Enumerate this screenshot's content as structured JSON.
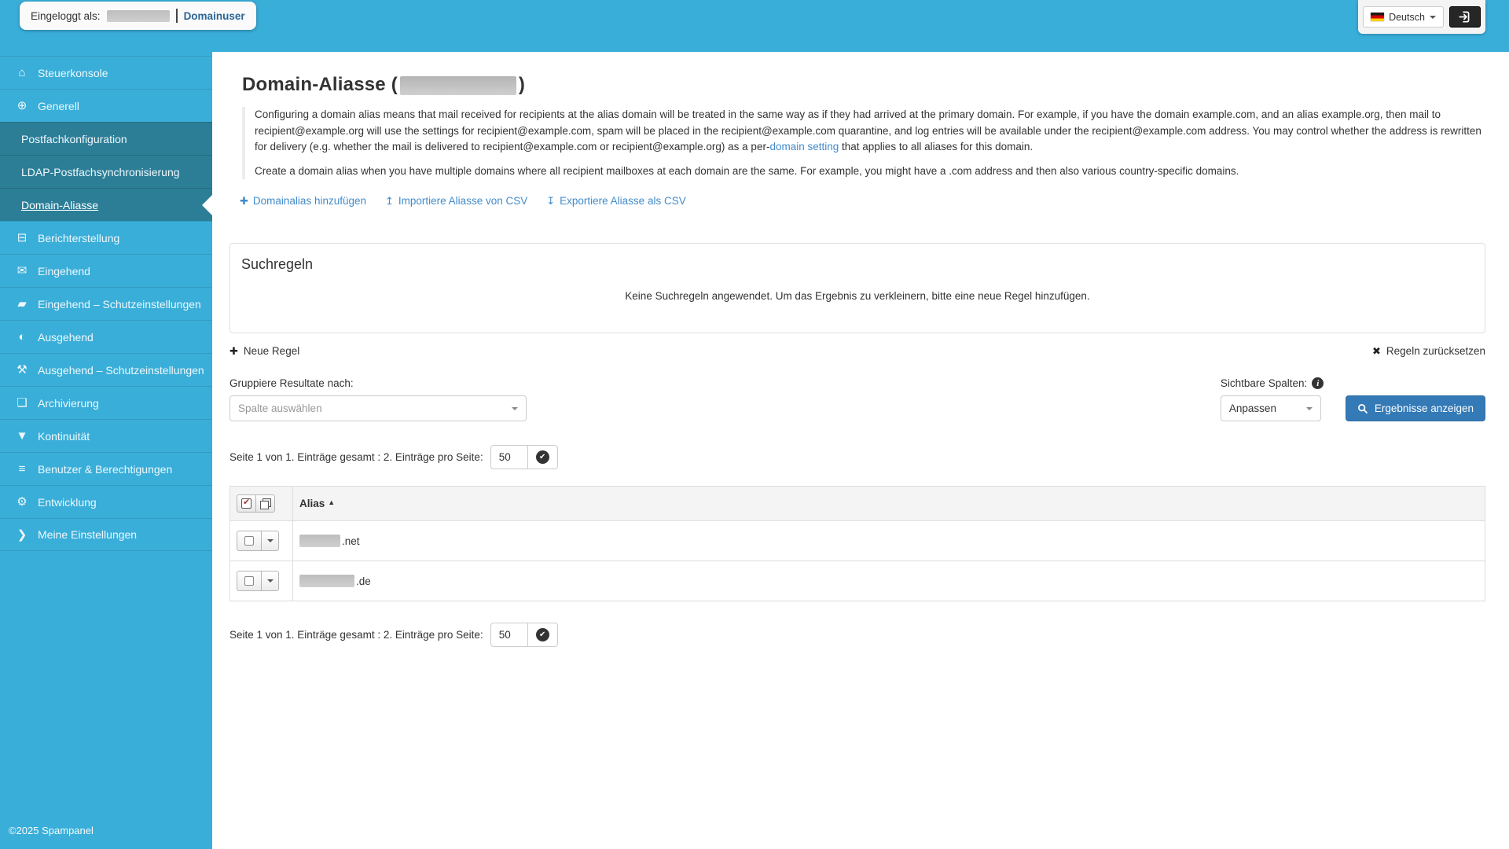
{
  "colors": {
    "accent": "#39aed9",
    "submenu": "#2c7e97",
    "link": "#428bca",
    "primary_button": "#337ab7"
  },
  "topbar": {
    "logged_in_label": "Eingeloggt als:",
    "role": "Domainuser",
    "language": "Deutsch"
  },
  "sidebar": {
    "items": [
      {
        "label": "Steuerkonsole",
        "icon": "home-icon"
      },
      {
        "label": "Generell",
        "icon": "globe-icon"
      },
      {
        "label": "Postfachkonfiguration",
        "sub": true
      },
      {
        "label": "LDAP-Postfachsynchronisierung",
        "sub": true
      },
      {
        "label": "Domain-Aliasse",
        "sub": true,
        "active": true
      },
      {
        "label": "Berichterstellung",
        "icon": "inbox-icon"
      },
      {
        "label": "Eingehend",
        "icon": "envelope-icon"
      },
      {
        "label": "Eingehend – Schutzeinstellungen",
        "icon": "folder-open-icon"
      },
      {
        "label": "Ausgehend",
        "icon": "adjust-icon"
      },
      {
        "label": "Ausgehend – Schutzeinstellungen",
        "icon": "wrench-icon"
      },
      {
        "label": "Archivierung",
        "icon": "file-icon"
      },
      {
        "label": "Kontinuität",
        "icon": "filter-icon"
      },
      {
        "label": "Benutzer & Berechtigungen",
        "icon": "list-icon"
      },
      {
        "label": "Entwicklung",
        "icon": "gear-icon"
      },
      {
        "label": "Meine Einstellungen",
        "icon": "chevron-right-icon"
      }
    ],
    "footer": "©2025 Spampanel"
  },
  "main": {
    "title_prefix": "Domain-Aliasse (",
    "title_suffix": ")",
    "intro_p1_a": "Configuring a domain alias means that mail received for recipients at the alias domain will be treated in the same way as if they had arrived at the primary domain. For example, if you have the domain example.com, and an alias example.org, then mail to recipient@example.org will use the settings for recipient@example.com, spam will be placed in the recipient@example.com quarantine, and log entries will be available under the recipient@example.com address. You may control whether the address is rewritten for delivery (e.g. whether the mail is delivered to recipient@example.com or recipient@example.org) as a per-",
    "intro_link": "domain setting",
    "intro_p1_b": " that applies to all aliases for this domain.",
    "intro_p2": "Create a domain alias when you have multiple domains where all recipient mailboxes at each domain are the same. For example, you might have a .com address and then also various country-specific domains.",
    "actions": [
      {
        "icon": "plus-icon",
        "label": "Domainalias hinzufügen"
      },
      {
        "icon": "upload-icon",
        "label": "Importiere Aliasse von CSV"
      },
      {
        "icon": "download-icon",
        "label": "Exportiere Aliasse als CSV"
      }
    ],
    "search_panel": {
      "title": "Suchregeln",
      "empty_message": "Keine Suchregeln angewendet. Um das Ergebnis zu verkleinern, bitte eine neue Regel hinzufügen."
    },
    "new_rule": "Neue Regel",
    "reset_rules": "Regeln zurücksetzen",
    "group_by_label": "Gruppiere Resultate nach:",
    "group_by_placeholder": "Spalte auswählen",
    "visible_columns_label": "Sichtbare Spalten:",
    "customize": "Anpassen",
    "show_results": "Ergebnisse anzeigen",
    "pagination": {
      "text": "Seite 1 von 1. Einträge gesamt : 2. Einträge pro Seite:",
      "page_size": "50"
    },
    "table": {
      "column": "Alias",
      "rows": [
        {
          "masked_width": 52,
          "suffix": ".net"
        },
        {
          "masked_width": 70,
          "suffix": ".de"
        }
      ]
    }
  },
  "icons": {
    "home-icon": "⌂",
    "globe-icon": "⊕",
    "inbox-icon": "⊟",
    "envelope-icon": "✉",
    "folder-open-icon": "▰",
    "adjust-icon": "◐",
    "wrench-icon": "⚒",
    "file-icon": "❏",
    "filter-icon": "▼",
    "list-icon": "≡",
    "gear-icon": "⚙",
    "chevron-right-icon": "❯",
    "plus-icon": "✚",
    "x-icon": "✖",
    "upload-icon": "↥",
    "download-icon": "↧",
    "sort-asc-icon": "▲"
  }
}
